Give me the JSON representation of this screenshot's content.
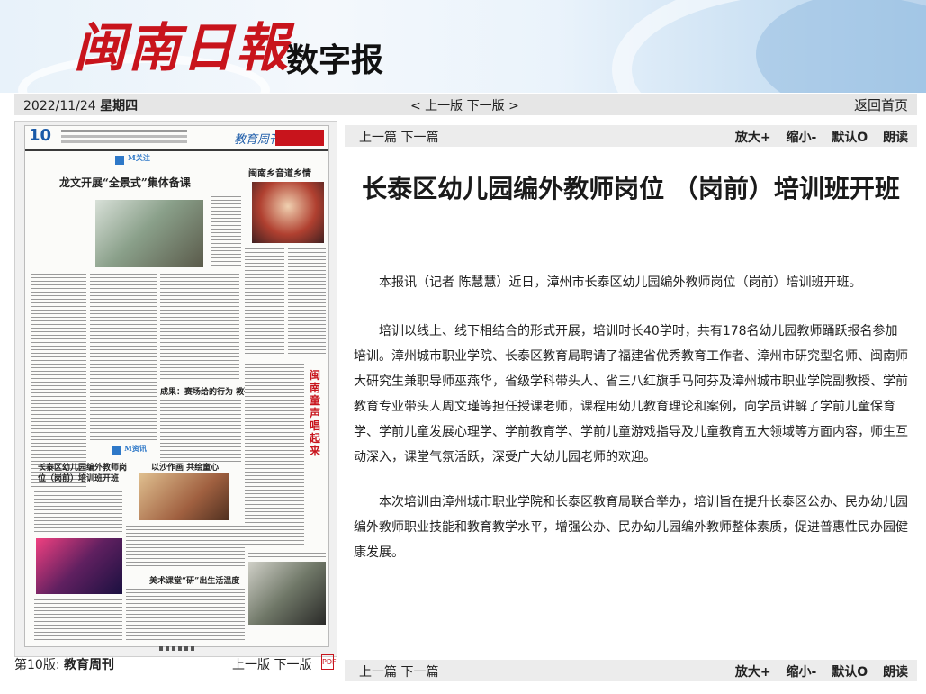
{
  "header": {
    "logo_text": "闽南日報",
    "subtitle": "数字报"
  },
  "datebar": {
    "date": "2022/11/24",
    "weekday": "星期四",
    "nav_prev": "< 上一版",
    "nav_next": "下一版 >",
    "home": "返回首页"
  },
  "page_thumb": {
    "page_number": "10",
    "section_masthead": "教育周刊",
    "headline_top_left": "龙文开展“全景式”集体备课",
    "headline_top_right": "闽南乡音道乡情",
    "headline_mid_right": "闽南童声唱起来",
    "headline_mid": "成果：赛场给的行为 教研探究",
    "headline_bottom_left": "长泰区幼儿园编外教师岗位（岗前）培训班开班",
    "headline_bottom_mid": "以沙作画 共绘童心",
    "headline_bottom_mid2": "美术课堂“研”出生活温度",
    "tag1": "M关注",
    "tag2": "M资讯"
  },
  "footer_left": {
    "page_label": "第10版:",
    "section": "教育周刊",
    "prev": "上一版",
    "next": "下一版",
    "pdf_label": "PDF"
  },
  "toolbar": {
    "prev_article": "上一篇",
    "next_article": "下一篇",
    "zoom_in": "放大+",
    "zoom_out": "缩小-",
    "default": "默认O",
    "read_aloud": "朗读"
  },
  "article": {
    "title": "长泰区幼儿园编外教师岗位 （岗前）培训班开班",
    "paragraphs": [
      "本报讯（记者 陈慧慧）近日，漳州市长泰区幼儿园编外教师岗位（岗前）培训班开班。",
      "培训以线上、线下相结合的形式开展，培训时长40学时，共有178名幼儿园教师踊跃报名参加培训。漳州城市职业学院、长泰区教育局聘请了福建省优秀教育工作者、漳州市研究型名师、闽南师大研究生兼职导师巫燕华，省级学科带头人、省三八红旗手马阿芬及漳州城市职业学院副教授、学前教育专业带头人周文瑾等担任授课老师，课程用幼儿教育理论和案例，向学员讲解了学前儿童保育学、学前儿童发展心理学、学前教育学、学前儿童游戏指导及儿童教育五大领域等方面内容，师生互动深入，课堂气氛活跃，深受广大幼儿园老师的欢迎。",
      "本次培训由漳州城市职业学院和长泰区教育局联合举办，培训旨在提升长泰区公办、民办幼儿园编外教师职业技能和教育教学水平，增强公办、民办幼儿园编外教师整体素质，促进普惠性民办园健康发展。"
    ]
  }
}
